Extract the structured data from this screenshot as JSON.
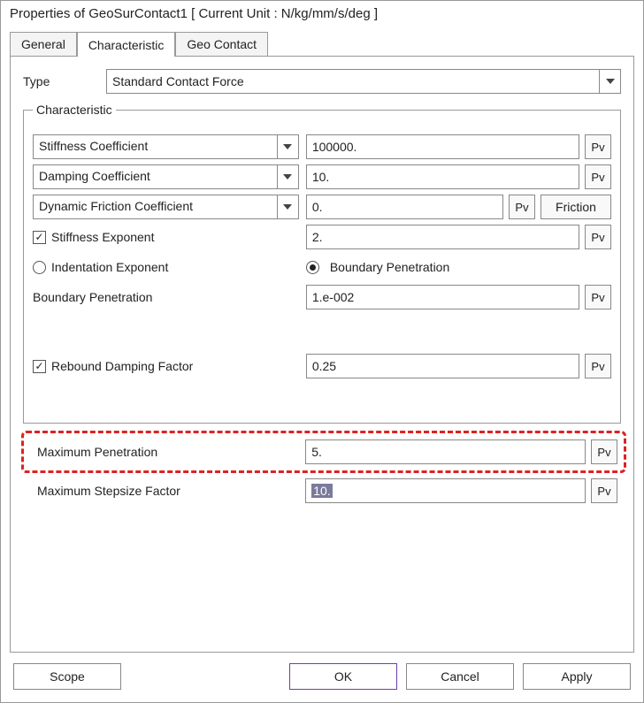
{
  "title": "Properties of GeoSurContact1 [ Current Unit : N/kg/mm/s/deg ]",
  "tabs": {
    "general": "General",
    "characteristic": "Characteristic",
    "geocontact": "Geo Contact"
  },
  "type_label": "Type",
  "type_value": "Standard Contact Force",
  "fieldset_title": "Characteristic",
  "pv": "Pv",
  "friction_btn": "Friction",
  "rows": {
    "stiff_coef": {
      "label": "Stiffness Coefficient",
      "value": "100000."
    },
    "damp_coef": {
      "label": "Damping Coefficient",
      "value": "10."
    },
    "dyn_fric": {
      "label": "Dynamic Friction Coefficient",
      "value": "0."
    },
    "stiff_exp": {
      "label": "Stiffness Exponent",
      "value": "2."
    },
    "indent_exp": {
      "label": "Indentation Exponent"
    },
    "boundary_pen_radio": {
      "label": "Boundary Penetration"
    },
    "boundary_pen": {
      "label": "Boundary Penetration",
      "value": "1.e-002"
    },
    "rebound": {
      "label": "Rebound Damping Factor",
      "value": "0.25"
    },
    "max_pen": {
      "label": "Maximum Penetration",
      "value": "5."
    },
    "max_step": {
      "label": "Maximum Stepsize Factor",
      "value": "10."
    }
  },
  "buttons": {
    "scope": "Scope",
    "ok": "OK",
    "cancel": "Cancel",
    "apply": "Apply"
  }
}
